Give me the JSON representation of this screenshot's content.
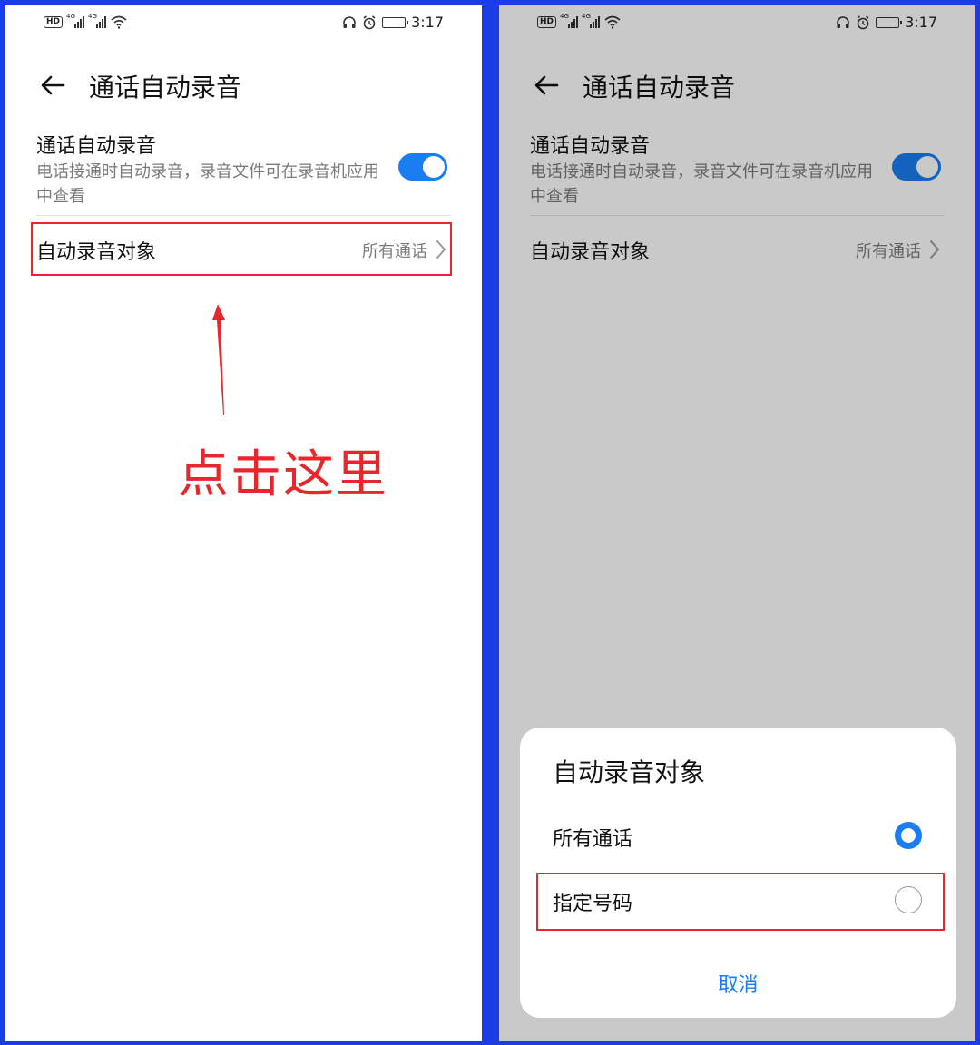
{
  "status_bar": {
    "hd_label": "HD",
    "network_1": "4G",
    "network_2": "4G",
    "time": "3:17"
  },
  "colors": {
    "accent": "#1a7df2",
    "annotation_red": "#e8262b",
    "frame_blue": "#1a3de8"
  },
  "icons": {
    "back": "arrow-left-icon",
    "chevron": "chevron-right-icon",
    "wifi": "wifi-icon",
    "alarm": "alarm-icon",
    "headset": "headset-icon",
    "battery": "battery-icon",
    "signal": "signal-icon"
  },
  "left_screen": {
    "page_title": "通话自动录音",
    "auto_record": {
      "title": "通话自动录音",
      "description": "电话接通时自动录音，录音文件可在录音机应用中查看",
      "enabled": true
    },
    "record_target": {
      "title": "自动录音对象",
      "value": "所有通话"
    },
    "annotation_text": "点击这里"
  },
  "right_screen": {
    "page_title": "通话自动录音",
    "auto_record": {
      "title": "通话自动录音",
      "description": "电话接通时自动录音，录音文件可在录音机应用中查看",
      "enabled": true
    },
    "record_target": {
      "title": "自动录音对象",
      "value": "所有通话"
    },
    "dialog": {
      "title": "自动录音对象",
      "options": [
        {
          "label": "所有通话",
          "selected": true
        },
        {
          "label": "指定号码",
          "selected": false
        }
      ],
      "cancel_label": "取消"
    }
  }
}
